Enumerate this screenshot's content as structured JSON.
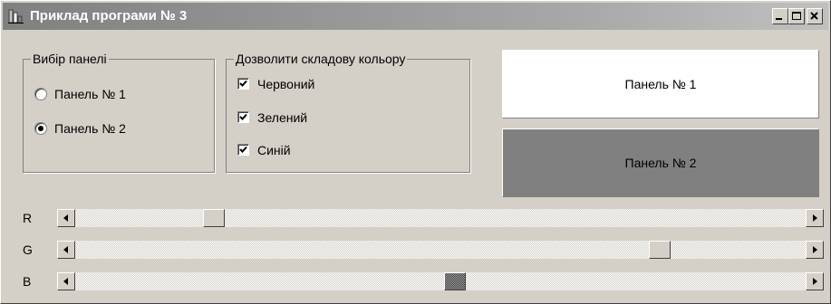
{
  "window": {
    "title": "Приклад програми № 3"
  },
  "panel_select": {
    "caption": "Вибір панелі",
    "options": [
      {
        "label": "Панель № 1",
        "checked": false
      },
      {
        "label": "Панель № 2",
        "checked": true
      }
    ]
  },
  "color_components": {
    "caption": "Дозволити складову кольору",
    "items": [
      {
        "label": "Червоний",
        "checked": true
      },
      {
        "label": "Зелений",
        "checked": true
      },
      {
        "label": "Синій",
        "checked": true
      }
    ]
  },
  "panels": [
    {
      "label": "Панель № 1",
      "color": "#ffffff"
    },
    {
      "label": "Панель № 2",
      "color": "#808080"
    }
  ],
  "scrollbars": [
    {
      "label": "R",
      "value": 0.18,
      "focused": false
    },
    {
      "label": "G",
      "value": 0.81,
      "focused": false
    },
    {
      "label": "B",
      "value": 0.52,
      "focused": true
    }
  ]
}
